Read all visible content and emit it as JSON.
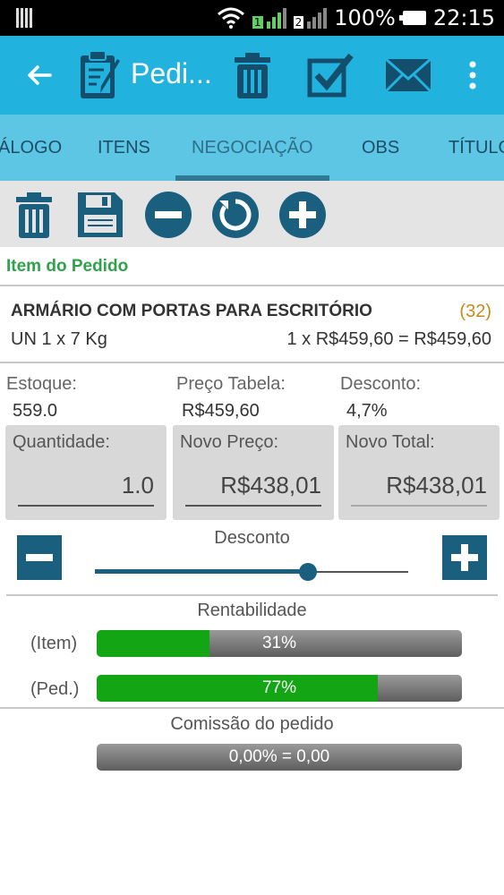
{
  "status_bar": {
    "battery": "100%",
    "time": "22:15",
    "sim1": "1",
    "sim2": "2"
  },
  "app_bar": {
    "title": "Pedi..."
  },
  "tabs": [
    "ÁLOGO",
    "ITENS",
    "NEGOCIAÇÃO",
    "OBS",
    "TÍTULO"
  ],
  "active_tab": "NEGOCIAÇÃO",
  "section_title": "Item do Pedido",
  "product": {
    "name": "ARMÁRIO COM PORTAS PARA ESCRITÓRIO",
    "count": "(32)",
    "unit": "UN 1 x 7 Kg",
    "calc": "1 x R$459,60 = R$459,60"
  },
  "info": {
    "estoque_label": "Estoque:",
    "estoque_value": "559.0",
    "preco_label": "Preço Tabela:",
    "preco_value": "R$459,60",
    "desconto_label": "Desconto:",
    "desconto_value": "4,7%"
  },
  "fields": {
    "quantidade_label": "Quantidade:",
    "quantidade_value": "1.0",
    "novo_preco_label": "Novo Preço:",
    "novo_preco_value": "R$438,01",
    "novo_total_label": "Novo Total:",
    "novo_total_value": "R$438,01"
  },
  "slider": {
    "label": "Desconto",
    "level": 0.68
  },
  "rentabilidade": {
    "title": "Rentabilidade",
    "item_label": "(Item)",
    "item_text": "31%",
    "item_level": 0.31,
    "ped_label": "(Ped.)",
    "ped_text": "77%",
    "ped_level": 0.77
  },
  "comissao": {
    "title": "Comissão do pedido",
    "text": "0,00% = 0,00",
    "level": 0
  },
  "colors": {
    "appbar": "#21b3de",
    "tabs": "#5cc6e4",
    "accent": "#1b5f7f",
    "green": "#14a514",
    "section": "#2fa24b",
    "count": "#c98a19"
  }
}
